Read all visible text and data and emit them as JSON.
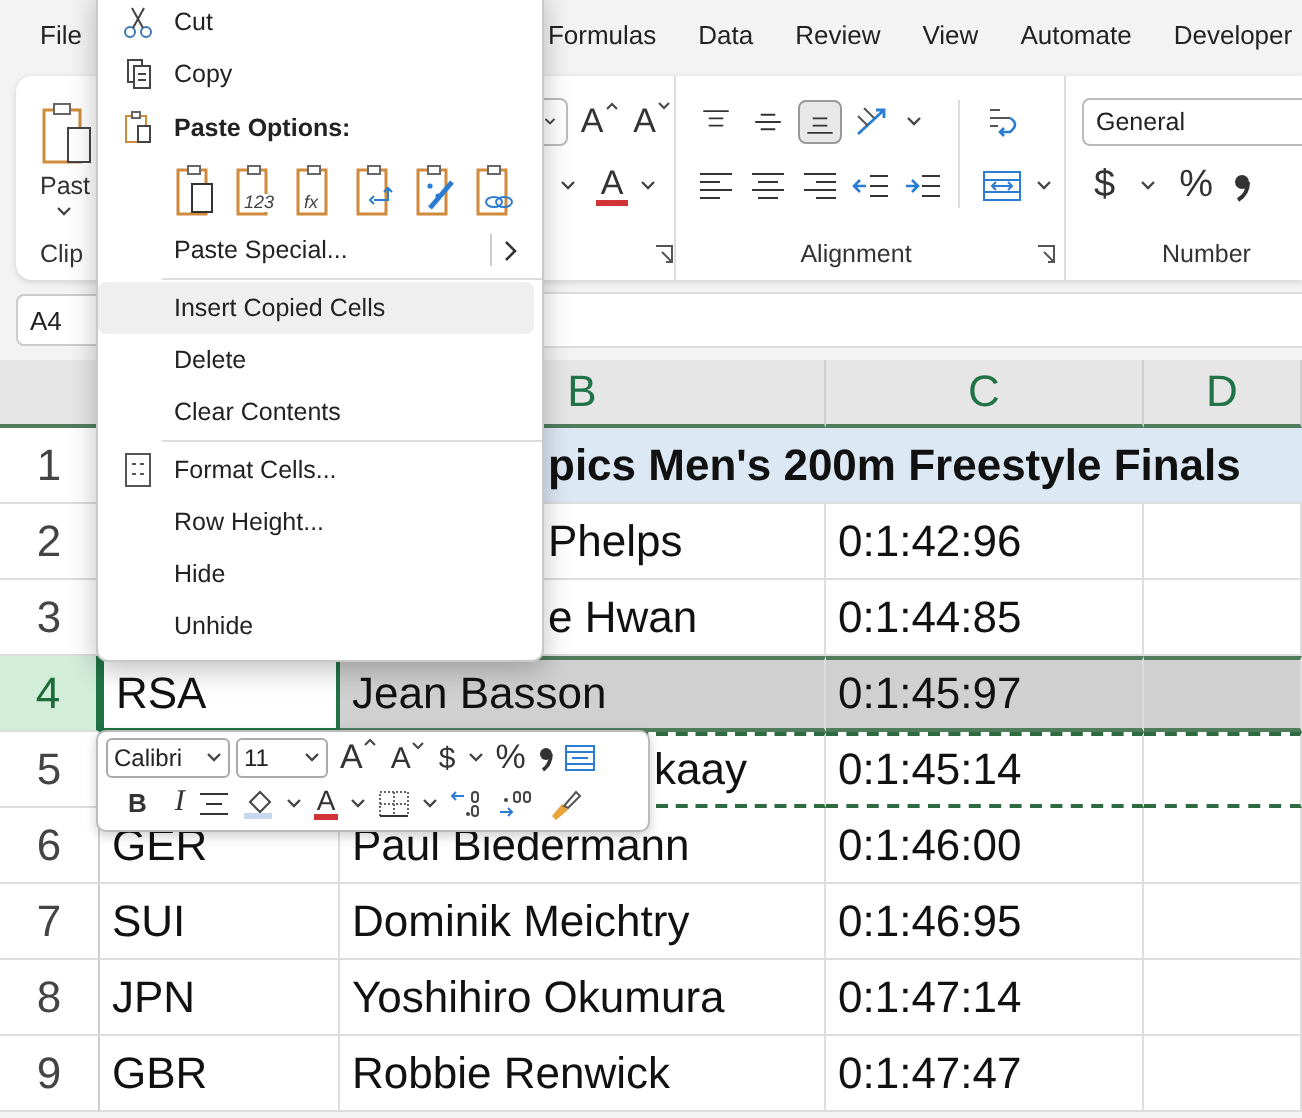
{
  "tabs": [
    {
      "label": "File",
      "selected": false
    },
    {
      "label": "Formulas",
      "selected": false
    },
    {
      "label": "Data",
      "selected": false
    },
    {
      "label": "Review",
      "selected": false
    },
    {
      "label": "View",
      "selected": false
    },
    {
      "label": "Automate",
      "selected": false
    },
    {
      "label": "Developer",
      "selected": false
    }
  ],
  "ribbon": {
    "clipboard": {
      "paste_label": "Past",
      "group_label": "Clip"
    },
    "font": {
      "grow_glyph": "A",
      "shrink_glyph": "A",
      "color_glyph": "A"
    },
    "alignment": {
      "label": "Alignment",
      "vertical": [
        {
          "kind": "top",
          "selected": false
        },
        {
          "kind": "middle",
          "selected": false
        },
        {
          "kind": "bottom",
          "selected": true
        }
      ]
    },
    "number": {
      "format": "General",
      "currency": "$",
      "percent": "%",
      "label": "Number"
    }
  },
  "name_box": "A4",
  "grid": {
    "columns": [
      "B",
      "C",
      "D"
    ],
    "rows": [
      {
        "number": "1",
        "kind": "title",
        "title": "pics Men's 200m Freestyle Finals",
        "selected": false,
        "copied": false
      },
      {
        "number": "2",
        "kind": "entry",
        "name": "Phelps",
        "time": "0:1:42:96",
        "selected": false,
        "copied": false
      },
      {
        "number": "3",
        "kind": "entry",
        "name": "e Hwan",
        "time": "0:1:44:85",
        "selected": false,
        "copied": false
      },
      {
        "number": "4",
        "kind": "entry",
        "country": "RSA",
        "name": "Jean Basson",
        "time": "0:1:45:97",
        "selected": true,
        "copied": false
      },
      {
        "number": "5",
        "kind": "entry",
        "name": "kaay",
        "time": "0:1:45:14",
        "selected": false,
        "copied": true
      },
      {
        "number": "6",
        "kind": "entry",
        "country": "GER",
        "name": "Paul Biedermann",
        "time": "0:1:46:00",
        "selected": false,
        "copied": false
      },
      {
        "number": "7",
        "kind": "entry",
        "country": "SUI",
        "name": "Dominik Meichtry",
        "time": "0:1:46:95",
        "selected": false,
        "copied": false
      },
      {
        "number": "8",
        "kind": "entry",
        "country": "JPN",
        "name": "Yoshihiro Okumura",
        "time": "0:1:47:14",
        "selected": false,
        "copied": false
      },
      {
        "number": "9",
        "kind": "entry",
        "country": "GBR",
        "name": "Robbie Renwick",
        "time": "0:1:47:47",
        "selected": false,
        "copied": false
      }
    ]
  },
  "context_menu": [
    {
      "kind": "item",
      "label": "Cut",
      "highlighted": false,
      "submenu": false
    },
    {
      "kind": "item",
      "label": "Copy",
      "highlighted": false,
      "submenu": false
    },
    {
      "kind": "header",
      "label": "Paste Options:"
    },
    {
      "kind": "paste_icons",
      "options": [
        {
          "kind": "plain"
        },
        {
          "kind": "values",
          "glyph": "123"
        },
        {
          "kind": "formulas",
          "glyph": "fx"
        },
        {
          "kind": "transpose"
        },
        {
          "kind": "formatting"
        },
        {
          "kind": "link"
        }
      ]
    },
    {
      "kind": "item",
      "label": "Paste Special...",
      "highlighted": false,
      "submenu": true
    },
    {
      "kind": "separator"
    },
    {
      "kind": "item",
      "label": "Insert Copied Cells",
      "highlighted": true,
      "submenu": false
    },
    {
      "kind": "item",
      "label": "Delete",
      "highlighted": false,
      "submenu": false
    },
    {
      "kind": "item",
      "label": "Clear Contents",
      "highlighted": false,
      "submenu": false
    },
    {
      "kind": "separator"
    },
    {
      "kind": "item",
      "label": "Format Cells...",
      "highlighted": false,
      "submenu": false
    },
    {
      "kind": "item",
      "label": "Row Height...",
      "highlighted": false,
      "submenu": false
    },
    {
      "kind": "item",
      "label": "Hide",
      "highlighted": false,
      "submenu": false
    },
    {
      "kind": "item",
      "label": "Unhide",
      "highlighted": false,
      "submenu": false
    }
  ],
  "mini_toolbar": {
    "font": "Calibri",
    "size": "11",
    "grow_glyph": "A",
    "shrink_glyph": "A",
    "currency": "$",
    "percent": "%",
    "bold": "B",
    "italic": "I",
    "color_glyph": "A"
  }
}
